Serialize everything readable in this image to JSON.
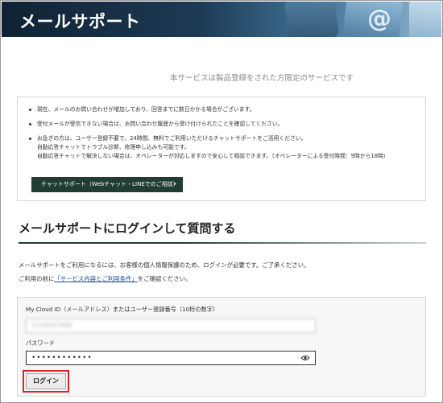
{
  "banner": {
    "title": "メールサポート",
    "decor_symbol": "@"
  },
  "notice": "本サービスは製品登録をされた方限定のサービスです",
  "info": {
    "items": [
      {
        "text": "現在、メールのお問い合わせが増加しており、回答までに数日かかる場合がございます。"
      },
      {
        "text": "受付メールが受信できない場合は、お問い合わせ履歴から受け付けられたことを確認してください。"
      },
      {
        "text": "お急ぎの方は、ユーザー登録不要で、24時間、無料でご利用いただけるチャットサポートをご活用ください。",
        "sub1": "自動応答チャットでトラブル診断、修理申し込みも可能です。",
        "sub2": "自動応答チャットで解決しない場合は、オペレーターが対応しますので安心して相談できます。（オペレーターによる受付時間：9時から18時）"
      }
    ],
    "chat_button": {
      "label": "チャットサポート（Webチャット・LINEでのご相談）",
      "arrow": "›"
    }
  },
  "section": {
    "heading": "メールサポートにログインして質問する",
    "intro_line1": "メールサポートをご利用になるには、お客様の個人情報保護のため、ログインが必要です。ご了承ください。",
    "intro_line2_prefix": "ご利用の前に",
    "intro_link": "「サービス内容とご利用条件」",
    "intro_line2_suffix": "をご確認ください。"
  },
  "form": {
    "id_label": "My Cloud ID（メールアドレス）またはユーザー登録番号（10桁の数字）",
    "id_value": "1234567890",
    "password_label": "パスワード",
    "password_value": "••••••••••••",
    "login_label": "ログイン"
  },
  "colors": {
    "accent": "#1f3d30",
    "highlight": "#d8232a",
    "link": "#1a4a9a"
  }
}
